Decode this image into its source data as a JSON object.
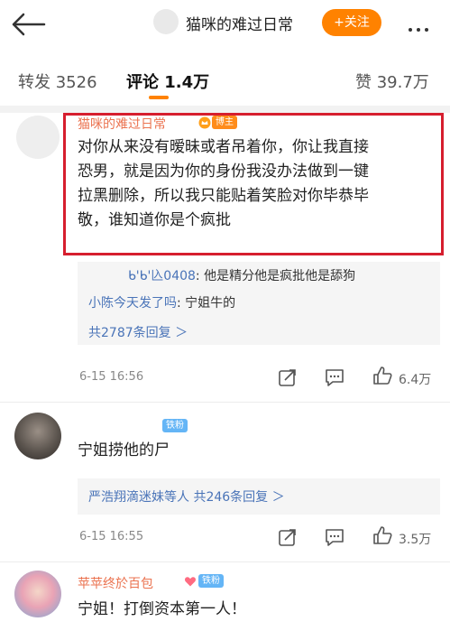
{
  "header": {
    "title": "猫咪的难过日常",
    "follow_label": "+关注"
  },
  "tabs": [
    {
      "label": "转发 3526"
    },
    {
      "label": "评论 1.4万"
    },
    {
      "label": "赞 39.7万"
    }
  ],
  "comments": [
    {
      "user": "猫咪的难过日常",
      "badge": "博主",
      "text_lines": [
        "对你从来没有暧昧或者吊着你，你让我直接",
        "恐男，就是因为你的身份我没办法做到一键",
        "拉黑删除，所以我只能贴着笑脸对你毕恭毕",
        "敬，谁知道你是个疯批"
      ],
      "replies": [
        {
          "user": "ᑲ'ᑲ'兦0408",
          "text": ": 他是精分他是疯批他是舔狗"
        },
        {
          "user": "小陈今天发了吗",
          "text": ": 宁姐牛的"
        }
      ],
      "more_replies": "共2787条回复 ＞",
      "time": "6-15 16:56",
      "likes": "6.4万"
    },
    {
      "user": "",
      "badge": "铁粉",
      "text": "宁姐捞他的尸",
      "more_replies": "严浩翔滴迷妹等人  共246条回复 ＞",
      "time": "6-15 16:55",
      "likes": "3.5万"
    },
    {
      "user": "苹苹终於百包",
      "badge": "铁粉",
      "text": "宁姐！打倒资本第一人！"
    }
  ],
  "colors": {
    "accent": "#ff8200",
    "name": "#eb7350",
    "link": "#4a74b8",
    "highlight": "#d61e2e"
  }
}
